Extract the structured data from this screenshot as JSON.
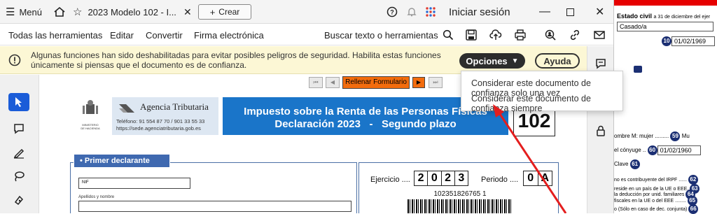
{
  "titlebar": {
    "menu_label": "Menú",
    "tab_title": "2023 Modelo 102 - I...",
    "crear_label": "Crear",
    "signin_label": "Iniciar sesión"
  },
  "toolbar": {
    "items": [
      "Todas las herramientas",
      "Editar",
      "Convertir",
      "Firma electrónica"
    ],
    "search_label": "Buscar texto o herramientas"
  },
  "warning": {
    "line1": "Algunas funciones han sido deshabilitadas para evitar posibles peligros de seguridad. Habilita estas funciones",
    "line2": "únicamente si piensas que el documento es de confianza.",
    "options_label": "Opciones",
    "help_label": "Ayuda"
  },
  "menu": {
    "items": [
      "Considerar este documento de confianza solo una vez",
      "Considerar este documento de confianza siempre"
    ]
  },
  "doc": {
    "nav_button": "Rellenar Formulario",
    "agency_name": "Agencia Tributaria",
    "agency_phone": "Teléfono: 91 554 87 70 / 901 33 55 33",
    "agency_url": "https://sede.agenciatributaria.gob.es",
    "ministry": "MINISTERIO\nDE HACIENDA",
    "title_line1": "Impuesto sobre la Renta de las Personas Físicas",
    "title_line2": "Declaración 2023   -   Segundo plazo",
    "model_number": "102",
    "section_label": "Primer declarante",
    "nif_label": "NIF",
    "name_label": "Apellidos y nombre",
    "ejercicio_label": "Ejercicio ....",
    "ejercicio_digits": [
      "2",
      "0",
      "2",
      "3"
    ],
    "periodo_label": "Periodo ....",
    "periodo_digits": [
      "0",
      "A"
    ],
    "barcode_number": "102351826765 1"
  },
  "bgform": {
    "estado_label": "Estado civil",
    "estado_sub": "a 31 de diciembre del ejer",
    "estado_value": "Casado/a",
    "field10_num": "10",
    "field10_value": "01/02/1969",
    "nombre_m_label": "ombre M: mujer .........",
    "field59_num": "59",
    "field59_value": "Mu",
    "conyuge_label": "el cónyuge ..",
    "field60_num": "60",
    "field60_value": "01/02/1960",
    "clave_label": "Clave",
    "field61_num": "61",
    "line1": "no es contribuyente del IRPF ......",
    "line2": "reside en un país de la UE o EEE,",
    "line3": "la deducción por unid. familiares",
    "line4": "fiscales en la UE o del EEE ........",
    "line5": "o (Sólo en caso de dec. conjunta)",
    "num62": "62",
    "num63": "63",
    "num64": "64",
    "num65": "65",
    "num66": "66"
  }
}
